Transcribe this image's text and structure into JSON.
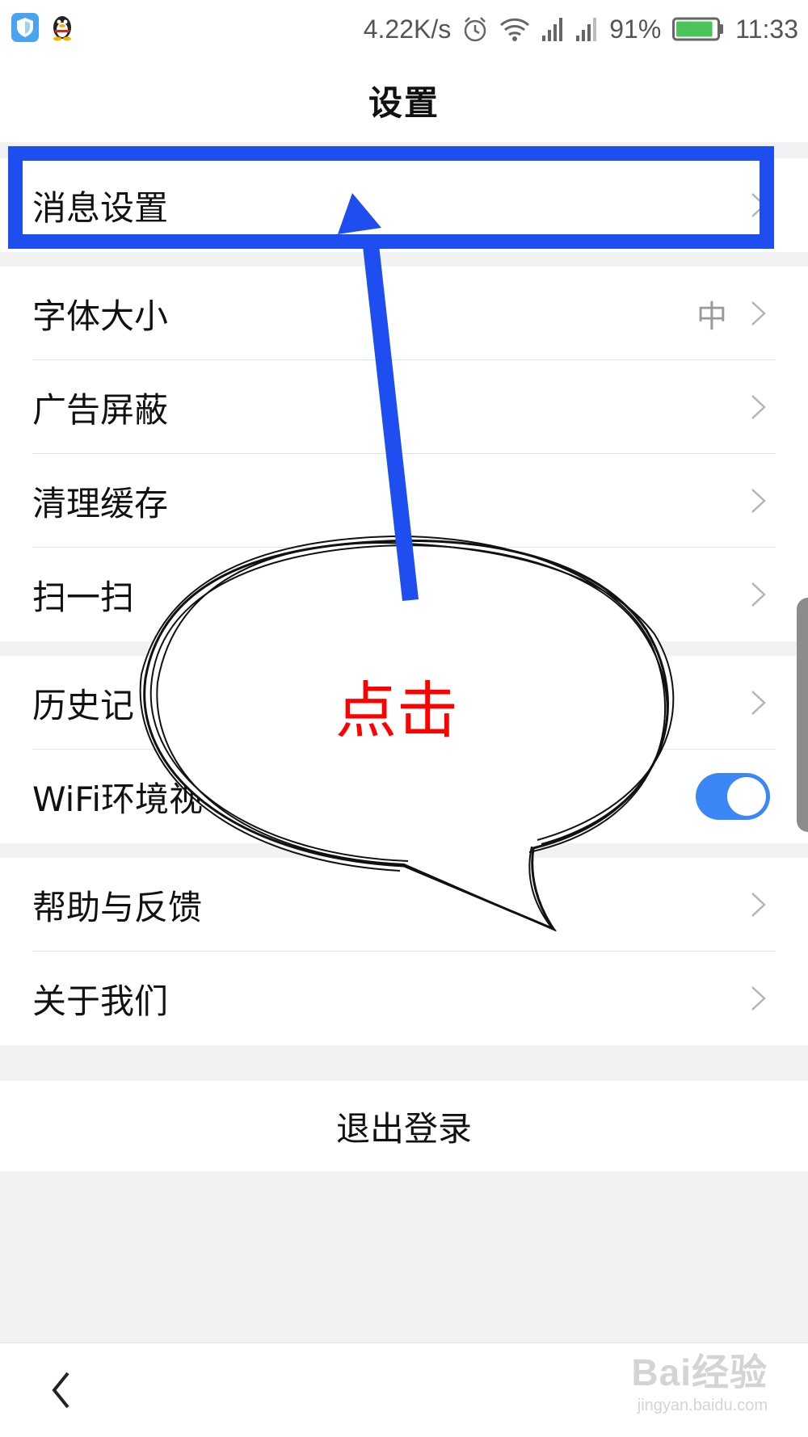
{
  "status_bar": {
    "network_speed": "4.22K/s",
    "battery": "91%",
    "time": "11:33",
    "icons": [
      "shield-app-icon",
      "qq-penguin-icon",
      "alarm-icon",
      "wifi-icon",
      "signal-icon",
      "signal-icon",
      "battery-icon"
    ],
    "battery_level": 0.91,
    "battery_color": "#4cc45a"
  },
  "header": {
    "title": "设置"
  },
  "settings": {
    "group1": [
      {
        "label": "消息设置"
      }
    ],
    "group2": [
      {
        "label": "字体大小",
        "value": "中"
      },
      {
        "label": "广告屏蔽"
      },
      {
        "label": "清理缓存"
      },
      {
        "label": "扫一扫"
      }
    ],
    "group3": [
      {
        "label": "历史记"
      },
      {
        "label": "WiFi环境视",
        "toggle_on": true
      }
    ],
    "group4": [
      {
        "label": "帮助与反馈"
      },
      {
        "label": "关于我们"
      }
    ]
  },
  "logout": {
    "label": "退出登录"
  },
  "annotation": {
    "callout_text": "点击",
    "highlight_color": "#1f4ef0",
    "callout_text_color": "#ff0000"
  },
  "bottom_bar": {
    "watermark_logo": "Bai经验",
    "watermark_url": "jingyan.baidu.com"
  },
  "colors": {
    "accent": "#3b87f5",
    "background": "#f2f2f4",
    "chevron": "#b5b5b5"
  }
}
